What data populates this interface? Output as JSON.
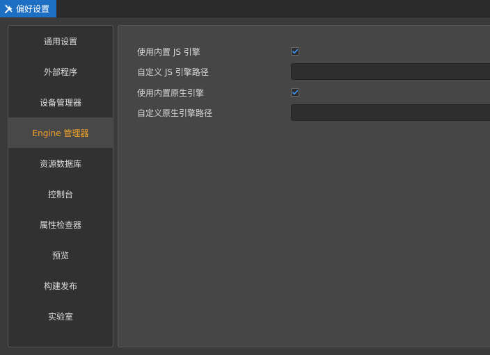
{
  "window": {
    "tab_title": "偏好设置",
    "tab_icon": "tools-icon",
    "accent_color": "#1d6fc4",
    "active_color": "#f0a32a"
  },
  "sidebar": {
    "items": [
      {
        "label": "通用设置",
        "active": false
      },
      {
        "label": "外部程序",
        "active": false
      },
      {
        "label": "设备管理器",
        "active": false
      },
      {
        "label": "Engine 管理器",
        "active": true
      },
      {
        "label": "资源数据库",
        "active": false
      },
      {
        "label": "控制台",
        "active": false
      },
      {
        "label": "属性检查器",
        "active": false
      },
      {
        "label": "预览",
        "active": false
      },
      {
        "label": "构建发布",
        "active": false
      },
      {
        "label": "实验室",
        "active": false
      }
    ]
  },
  "engine": {
    "use_builtin_js_label": "使用内置 JS 引擎",
    "use_builtin_js_checked": true,
    "custom_js_path_label": "自定义 JS 引擎路径",
    "custom_js_path_value": "",
    "use_builtin_native_label": "使用内置原生引擎",
    "use_builtin_native_checked": true,
    "custom_native_path_label": "自定义原生引擎路径",
    "custom_native_path_value": ""
  }
}
